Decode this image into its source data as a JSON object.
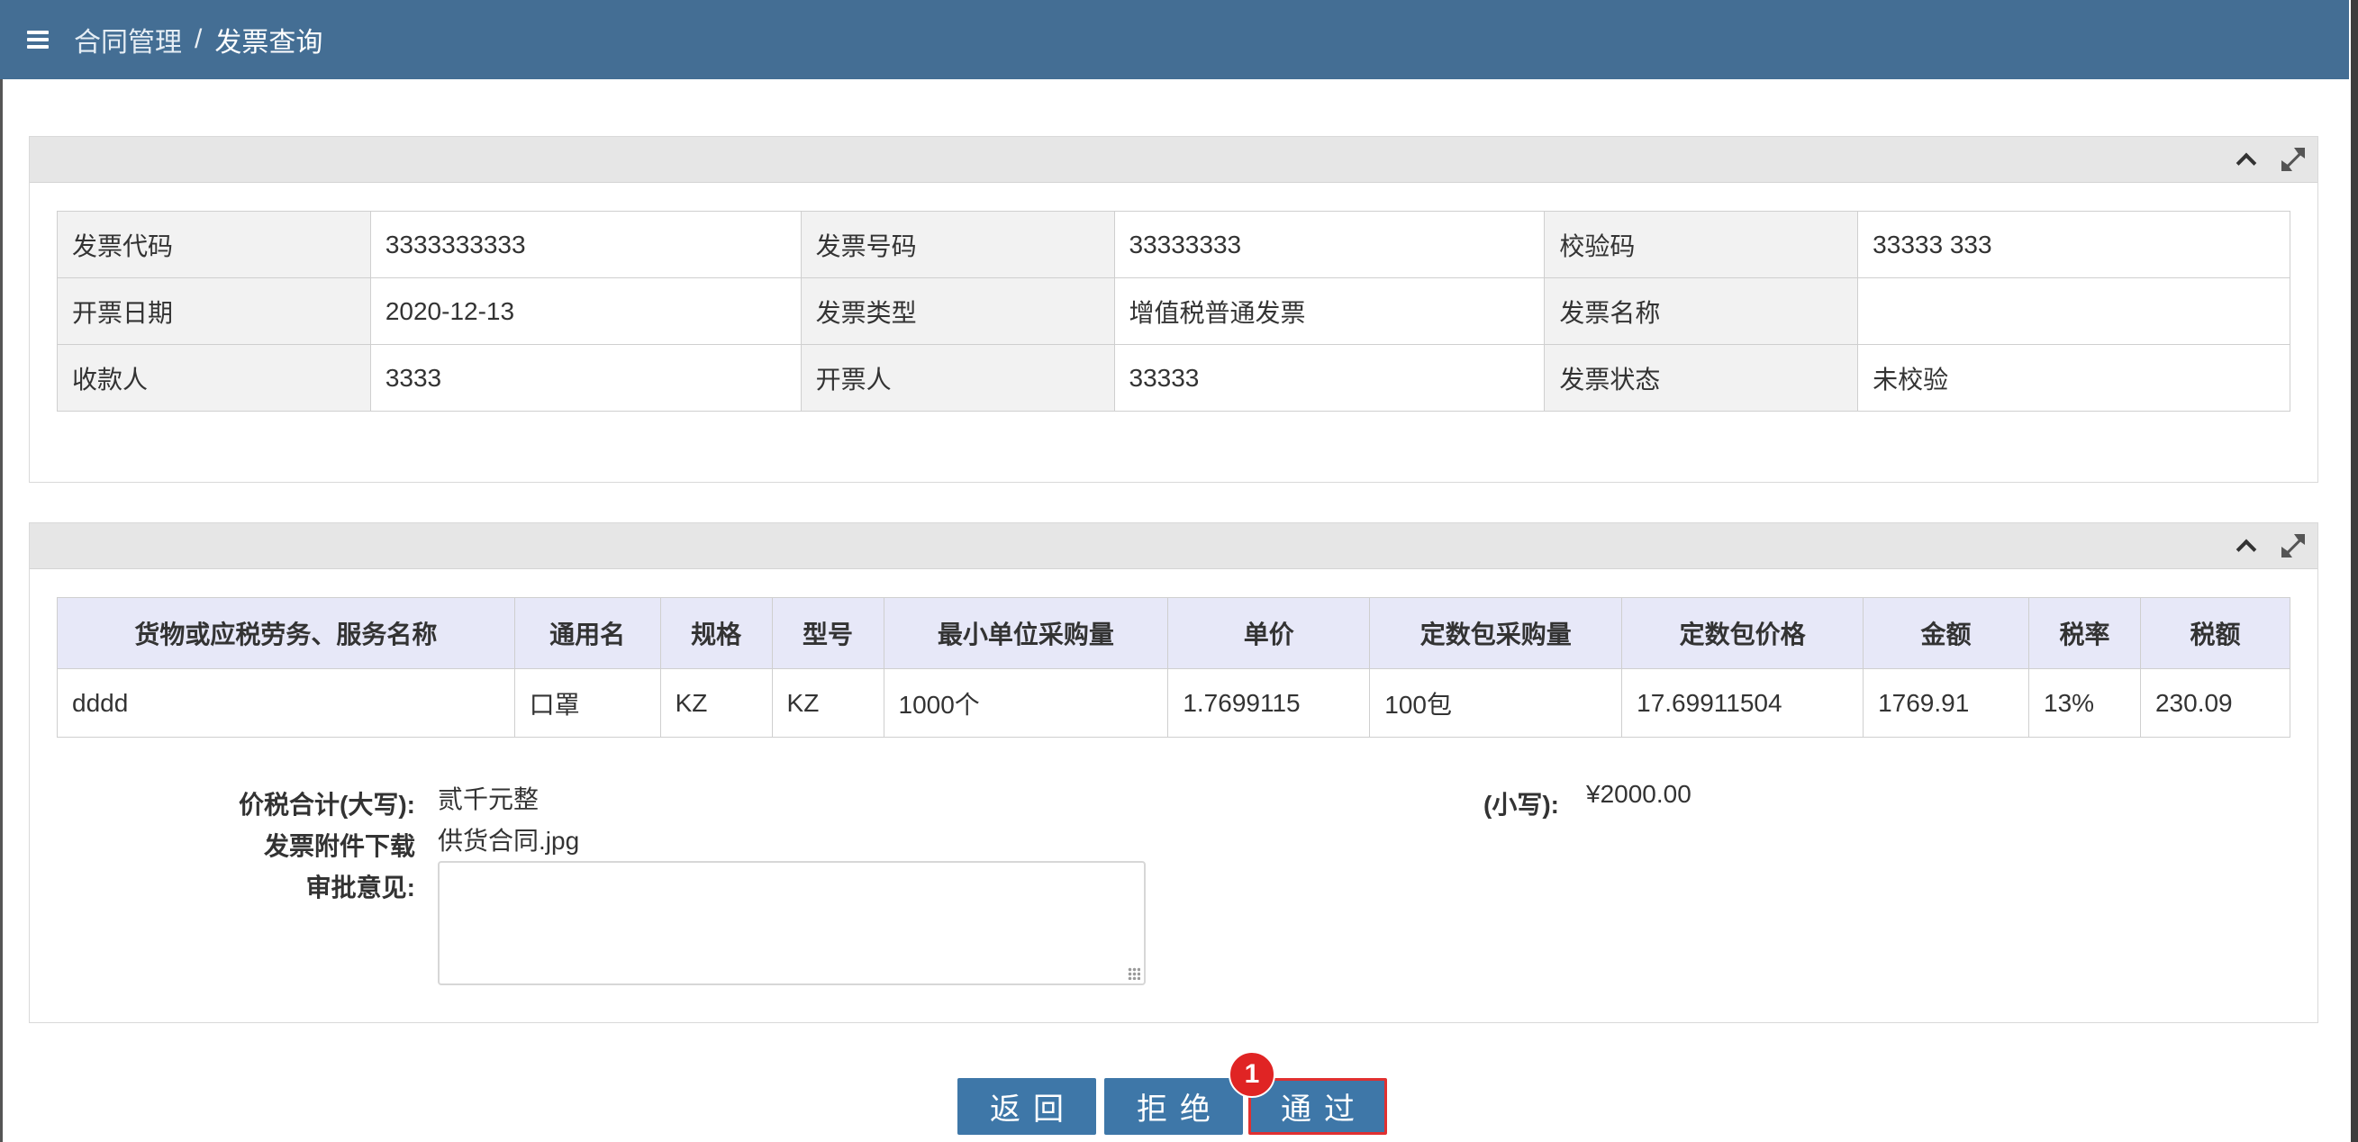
{
  "breadcrumb": {
    "parent": "合同管理",
    "separator": "/",
    "current": "发票查询"
  },
  "invoice_info": {
    "rows": [
      [
        {
          "label": "发票代码",
          "value": "3333333333"
        },
        {
          "label": "发票号码",
          "value": "33333333"
        },
        {
          "label": "校验码",
          "value": "33333 333"
        }
      ],
      [
        {
          "label": "开票日期",
          "value": "2020-12-13"
        },
        {
          "label": "发票类型",
          "value": "增值税普通发票"
        },
        {
          "label": "发票名称",
          "value": ""
        }
      ],
      [
        {
          "label": "收款人",
          "value": "3333"
        },
        {
          "label": "开票人",
          "value": "33333"
        },
        {
          "label": "发票状态",
          "value": "未校验"
        }
      ]
    ]
  },
  "goods": {
    "headers": [
      "货物或应税劳务、服务名称",
      "通用名",
      "规格",
      "型号",
      "最小单位采购量",
      "单价",
      "定数包采购量",
      "定数包价格",
      "金额",
      "税率",
      "税额"
    ],
    "rows": [
      [
        "dddd",
        "口罩",
        "KZ",
        "KZ",
        "1000个",
        "1.7699115",
        "100包",
        "17.69911504",
        "1769.91",
        "13%",
        "230.09"
      ]
    ]
  },
  "summary": {
    "total_upper_label": "价税合计(大写):",
    "total_upper_value": "贰千元整",
    "total_lower_label": "(小写):",
    "total_lower_value": "¥2000.00",
    "attachment_label": "发票附件下载",
    "attachment_value": "供货合同.jpg",
    "approval_label": "审批意见:",
    "approval_value": ""
  },
  "buttons": {
    "back": "返回",
    "reject": "拒绝",
    "approve": "通过"
  },
  "badge": "1",
  "colors": {
    "header": "#446e94",
    "button": "#3e77a8",
    "badge": "#e02424",
    "table_header": "#e7e8f8"
  }
}
